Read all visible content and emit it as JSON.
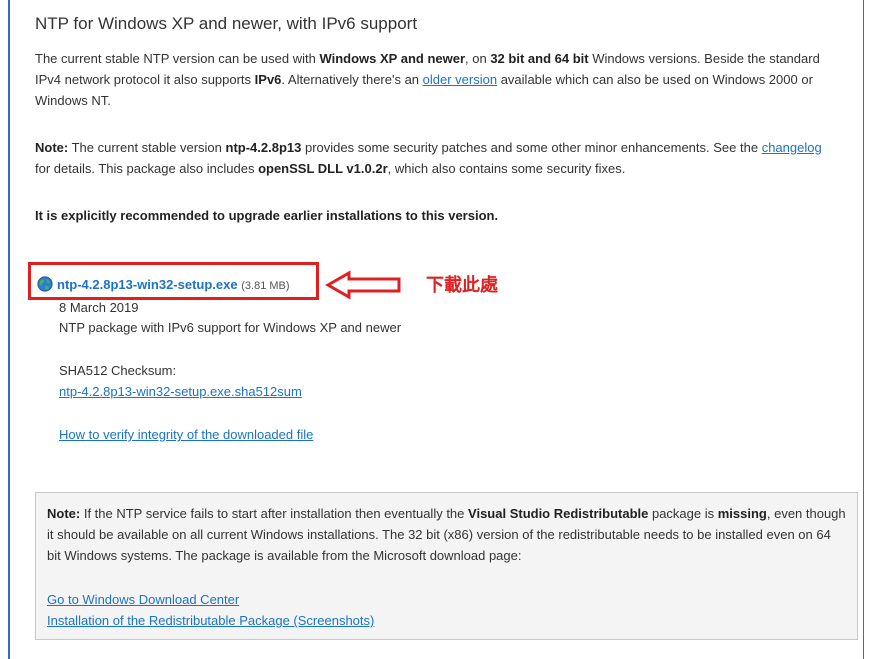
{
  "heading": "NTP for Windows XP and newer, with IPv6 support",
  "intro": {
    "t1": "The current stable NTP version can be used with ",
    "b1": "Windows XP and newer",
    "t2": ", on ",
    "b2": "32 bit and 64 bit",
    "t3": " Windows versions. Beside the standard IPv4 network protocol it also supports ",
    "b3": "IPv6",
    "t4": ". Alternatively there's an ",
    "link": "older version",
    "t5": " available which can also be used on Windows 2000 or Windows NT."
  },
  "note1": {
    "label": "Note:",
    "t1": " The current stable version ",
    "b1": "ntp-4.2.8p13",
    "t2": " provides some security patches and some other minor enhancements. See the ",
    "link": "changelog",
    "t3": " for details. This package also includes ",
    "b2": "openSSL DLL v1.0.2r",
    "t4": ", which also contains some security fixes."
  },
  "recommend": "It is explicitly recommended to upgrade earlier installations to this version.",
  "download": {
    "icon": "globe-icon",
    "filename": "ntp-4.2.8p13-win32-setup.exe",
    "size": "(3.81 MB)",
    "annotation": "下載此處",
    "highlight_color": "#e02020",
    "date": "8 March 2019",
    "description": "NTP package with IPv6 support for Windows XP and newer",
    "checksum_label": "SHA512 Checksum:",
    "checksum_link": "ntp-4.2.8p13-win32-setup.exe.sha512sum",
    "verify_link": "How to verify integrity of the downloaded file"
  },
  "note2": {
    "label": "Note:",
    "t1": " If the NTP service fails to start after installation then eventually the ",
    "b1": "Visual Studio Redistributable",
    "t2": " package is ",
    "b2": "missing",
    "t3": ", even though it should be available on all current Windows installations. The 32 bit (x86) version of the redistributable needs to be installed even on 64 bit Windows systems. The package is available from the Microsoft download page:",
    "link1": "Go to Windows Download Center",
    "link2": "Installation of the Redistributable Package (Screenshots)"
  },
  "colors": {
    "link": "#1a73c9",
    "accent_border": "#2c6fd1",
    "highlight": "#e02020",
    "note_bg": "#f4f4f4"
  }
}
